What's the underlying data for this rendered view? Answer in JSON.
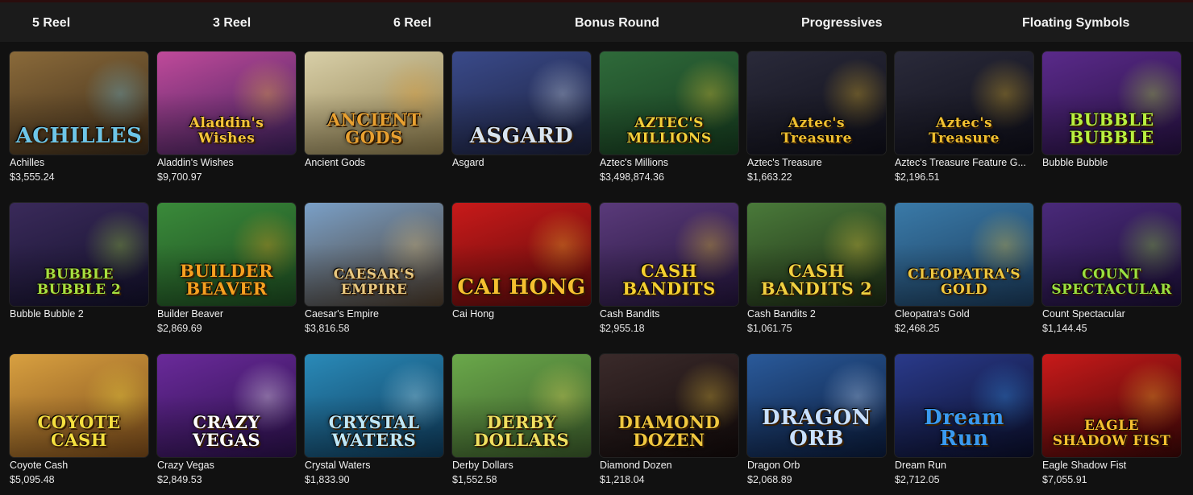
{
  "nav": {
    "tabs": [
      "5 Reel",
      "3 Reel",
      "6 Reel",
      "Bonus Round",
      "Progressives",
      "Floating Symbols"
    ]
  },
  "games": [
    {
      "name": "Achilles",
      "jackpot": "$3,555.24",
      "logo": "ACHILLES",
      "bg": "#8a6a3a",
      "bg2": "#3b2a18",
      "accent": "#6ec6e8"
    },
    {
      "name": "Aladdin's Wishes",
      "jackpot": "$9,700.97",
      "logo": "Aladdin's Wishes",
      "bg": "#c04a9a",
      "bg2": "#3a1f5a",
      "accent": "#f5c53a"
    },
    {
      "name": "Ancient Gods",
      "jackpot": "",
      "logo": "ANCIENT GODS",
      "bg": "#d8cfa8",
      "bg2": "#8b7a4a",
      "accent": "#e8a030"
    },
    {
      "name": "Asgard",
      "jackpot": "",
      "logo": "ASGARD",
      "bg": "#3a4a8a",
      "bg2": "#1a1f3a",
      "accent": "#d8e4f0"
    },
    {
      "name": "Aztec's Millions",
      "jackpot": "$3,498,874.36",
      "logo": "AZTEC'S MILLIONS",
      "bg": "#2f6a3a",
      "bg2": "#153a1e",
      "accent": "#f3d03a"
    },
    {
      "name": "Aztec's Treasure",
      "jackpot": "$1,663.22",
      "logo": "Aztec's Treasure",
      "bg": "#2a2a3a",
      "bg2": "#0e0e18",
      "accent": "#f0c030"
    },
    {
      "name": "Aztec's Treasure Feature G...",
      "jackpot": "$2,196.51",
      "logo": "Aztec's Treasure",
      "bg": "#2a2a3a",
      "bg2": "#0e0e18",
      "accent": "#f0c030"
    },
    {
      "name": "Bubble Bubble",
      "jackpot": "",
      "logo": "BUBBLE BUBBLE",
      "bg": "#5a2a8a",
      "bg2": "#24103e",
      "accent": "#b8f040"
    },
    {
      "name": "Bubble Bubble 2",
      "jackpot": "",
      "logo": "BUBBLE BUBBLE 2",
      "bg": "#3a2a5a",
      "bg2": "#12102a",
      "accent": "#a6e040"
    },
    {
      "name": "Builder Beaver",
      "jackpot": "$2,869.69",
      "logo": "BUILDER BEAVER",
      "bg": "#3a8a3a",
      "bg2": "#1c4a20",
      "accent": "#f5a020"
    },
    {
      "name": "Caesar's Empire",
      "jackpot": "$3,816.58",
      "logo": "CAESAR'S EMPIRE",
      "bg": "#7aa0c8",
      "bg2": "#4a3a2a",
      "accent": "#e8c880"
    },
    {
      "name": "Cai Hong",
      "jackpot": "",
      "logo": "CAI HONG",
      "bg": "#c81a1a",
      "bg2": "#5a0a0a",
      "accent": "#f5c030"
    },
    {
      "name": "Cash Bandits",
      "jackpot": "$2,955.18",
      "logo": "CASH BANDITS",
      "bg": "#5a3a7a",
      "bg2": "#22143a",
      "accent": "#f5d030"
    },
    {
      "name": "Cash Bandits 2",
      "jackpot": "$1,061.75",
      "logo": "CASH BANDITS 2",
      "bg": "#4a7a3a",
      "bg2": "#1c2a14",
      "accent": "#f0d040"
    },
    {
      "name": "Cleopatra's Gold",
      "jackpot": "$2,468.25",
      "logo": "CLEOPATRA'S GOLD",
      "bg": "#3a7aa8",
      "bg2": "#1a3a5a",
      "accent": "#f0c840"
    },
    {
      "name": "Count Spectacular",
      "jackpot": "$1,144.45",
      "logo": "COUNT SPECTACULAR",
      "bg": "#4a2a7a",
      "bg2": "#1a0e34",
      "accent": "#9ae040"
    },
    {
      "name": "Coyote Cash",
      "jackpot": "$5,095.48",
      "logo": "COYOTE CASH",
      "bg": "#d8a040",
      "bg2": "#7a4a1a",
      "accent": "#f5e040"
    },
    {
      "name": "Crazy Vegas",
      "jackpot": "$2,849.53",
      "logo": "CRAZY VEGAS",
      "bg": "#6a2a9a",
      "bg2": "#2a104a",
      "accent": "#ffffff"
    },
    {
      "name": "Crystal Waters",
      "jackpot": "$1,833.90",
      "logo": "CRYSTAL WATERS",
      "bg": "#2a8ab8",
      "bg2": "#0e3a5a",
      "accent": "#bfe8f8"
    },
    {
      "name": "Derby Dollars",
      "jackpot": "$1,552.58",
      "logo": "DERBY DOLLARS",
      "bg": "#6aa84a",
      "bg2": "#3a5a2a",
      "accent": "#f0e060"
    },
    {
      "name": "Diamond Dozen",
      "jackpot": "$1,218.04",
      "logo": "DIAMOND DOZEN",
      "bg": "#3a2a2a",
      "bg2": "#120a0a",
      "accent": "#f0c840"
    },
    {
      "name": "Dragon Orb",
      "jackpot": "$2,068.89",
      "logo": "DRAGON ORB",
      "bg": "#2a5a9a",
      "bg2": "#0a1a3a",
      "accent": "#c8e0ff"
    },
    {
      "name": "Dream Run",
      "jackpot": "$2,712.05",
      "logo": "Dream Run",
      "bg": "#2a3a8a",
      "bg2": "#0a0e2a",
      "accent": "#3a9af0"
    },
    {
      "name": "Eagle Shadow Fist",
      "jackpot": "$7,055.91",
      "logo": "EAGLE SHADOW FIST",
      "bg": "#c81a1a",
      "bg2": "#3a0606",
      "accent": "#f5c030"
    }
  ]
}
